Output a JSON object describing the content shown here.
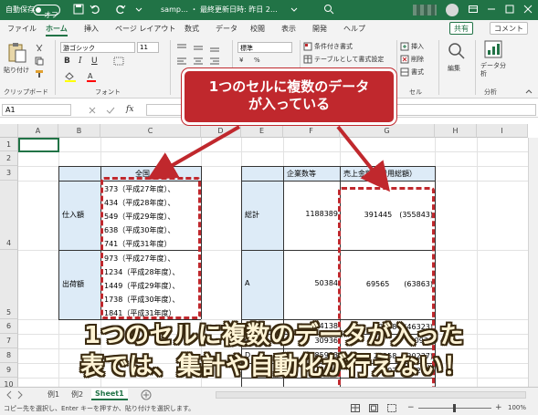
{
  "titlebar": {
    "autosave_label": "自動保存",
    "autosave_state": "オフ",
    "filename": "samp… ・ 最終更新日時: 昨日 2…"
  },
  "ribbon_tabs": [
    "ファイル",
    "ホーム",
    "挿入",
    "ページ レイアウト",
    "数式",
    "データ",
    "校閲",
    "表示",
    "開発",
    "ヘルプ"
  ],
  "share_label": "共有",
  "comment_label": "コメント",
  "ribbon": {
    "paste_label": "貼り付け",
    "clipboard_label": "クリップボード",
    "font_name": "游ゴシック",
    "font_size": "11",
    "font_label": "フォント",
    "bold": "B",
    "italic": "I",
    "underline": "U",
    "number_format": "標準",
    "number_label": "数",
    "cond_format": "条件付き書式",
    "table_format": "テーブルとして書式設定",
    "cell_style": "セルのスタイル",
    "insert_label": "挿入",
    "delete_label": "削除",
    "format_label": "書式",
    "cells_label": "セル",
    "edit_label": "編集",
    "data_analysis": "データ分析",
    "analysis_label": "分析",
    "yen": "¥",
    "percent": "%"
  },
  "formula_bar": {
    "namebox": "A1",
    "fx": "fx"
  },
  "columns": [
    "A",
    "B",
    "C",
    "D",
    "E",
    "F",
    "G",
    "H",
    "I"
  ],
  "rows": [
    "1",
    "2",
    "3",
    "4",
    "5",
    "6",
    "7",
    "8",
    "9",
    "10"
  ],
  "cells": {
    "c3": "全国",
    "b4": "仕入額",
    "c4_lines": [
      "373（平成27年度）、",
      "434（平成28年度）、",
      "549（平成29年度）、",
      "638（平成30年度）、",
      "741（平成31年度）"
    ],
    "b5": "出荷額",
    "c5_lines": [
      "973（平成27年度）、",
      "1234（平成28年度）、",
      "1449（平成29年度）、",
      "1738（平成30年度）、",
      "1841（平成31年度）"
    ],
    "f3": "企業数等",
    "g3": "売上金額（費用総額）",
    "e4": "総計",
    "f4": "1188389",
    "g4": "391445　(355843)",
    "e5": "A",
    "f5": "50384",
    "g5": "69565　　(63863)",
    "f6": "154138",
    "g6": "50468　(46323)",
    "e7": "C",
    "f7": "30936",
    "g7": "30936",
    "e8": "D",
    "f8": "85983",
    "g8": "22258　(20237)",
    "f9": "79887",
    "g9": "20107　(18295)"
  },
  "sheet_tabs": [
    "例1",
    "例2",
    "Sheet1"
  ],
  "statusbar": {
    "message": "コピー先を選択し、Enter キーを押すか、貼り付けを選択します。",
    "zoom": "100%"
  },
  "callout": {
    "line1": "1つのセルに複数のデータ",
    "line2": "が入っている"
  },
  "headline": {
    "line1": "1つのセルに複数のデータが入った",
    "line2": "表では、集計や自動化が行えない！"
  },
  "colors": {
    "excel_green": "#217346",
    "annotation_red": "#c0282d",
    "header_blue": "#ddebf7"
  }
}
